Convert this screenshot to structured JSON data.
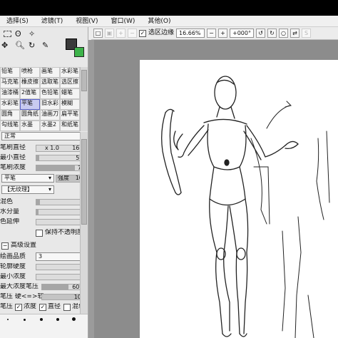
{
  "menu": [
    "选择(S)",
    "滤镜(T)",
    "视图(V)",
    "窗口(W)",
    "其他(O)"
  ],
  "toolbar": {
    "clip_label": "选区边缘",
    "zoom": "16.66%",
    "rotation": "+000°"
  },
  "brush_grid": [
    [
      "铅笔",
      "喷枪",
      "画笔",
      "水彩笔"
    ],
    [
      "马克笔",
      "橡皮擦",
      "选取笔",
      "选区擦"
    ],
    [
      "油漆桶",
      "2值笔",
      "色铅笔",
      "蜡笔"
    ],
    [
      "水彩笔",
      "平笔",
      "旧水彩",
      "模糊"
    ],
    [
      "圆角",
      "圆角纸",
      "油画刀",
      "扁平笔"
    ],
    [
      "勾线笔",
      "水墨",
      "水墨2",
      "和纸笔"
    ]
  ],
  "brush": {
    "blend_mode": "正常",
    "size_label": "笔刷直径",
    "size_multiplier": "x 1.0",
    "size_value": "16.0",
    "min_size_label": "最小直径",
    "min_size_value": "5%",
    "density_label": "笔刷浓度",
    "density_value": "77",
    "shape_select": "平笔",
    "strength_label": "强度",
    "strength_value": "100",
    "texture_select": "【无纹理】",
    "blending_label": "混色",
    "blending_value": "7",
    "water_label": "水分量",
    "water_value": "4",
    "persistence_label": "色延伸",
    "persistence_value": "0",
    "keep_opacity_label": "保持不透明度",
    "advanced_label": "高级设置",
    "quality_label": "绘画品质",
    "quality_value": "3",
    "edge_label": "轮廓硬度",
    "edge_value": "0",
    "min_density_label": "最小浓度",
    "min_density_value": "0",
    "max_pressure_label": "最大浓度笔压",
    "max_pressure_value": "60%",
    "pressure_hard_label": "笔压 硬<=>软",
    "pressure_hard_value": "100",
    "pressure_label": "笔压",
    "density_check": "浓度",
    "size_check": "直径",
    "blend_check": "混色"
  },
  "colors": {
    "primary": "#3a3a3a",
    "secondary": "#3db34a",
    "selected": "#c9cbf0"
  }
}
